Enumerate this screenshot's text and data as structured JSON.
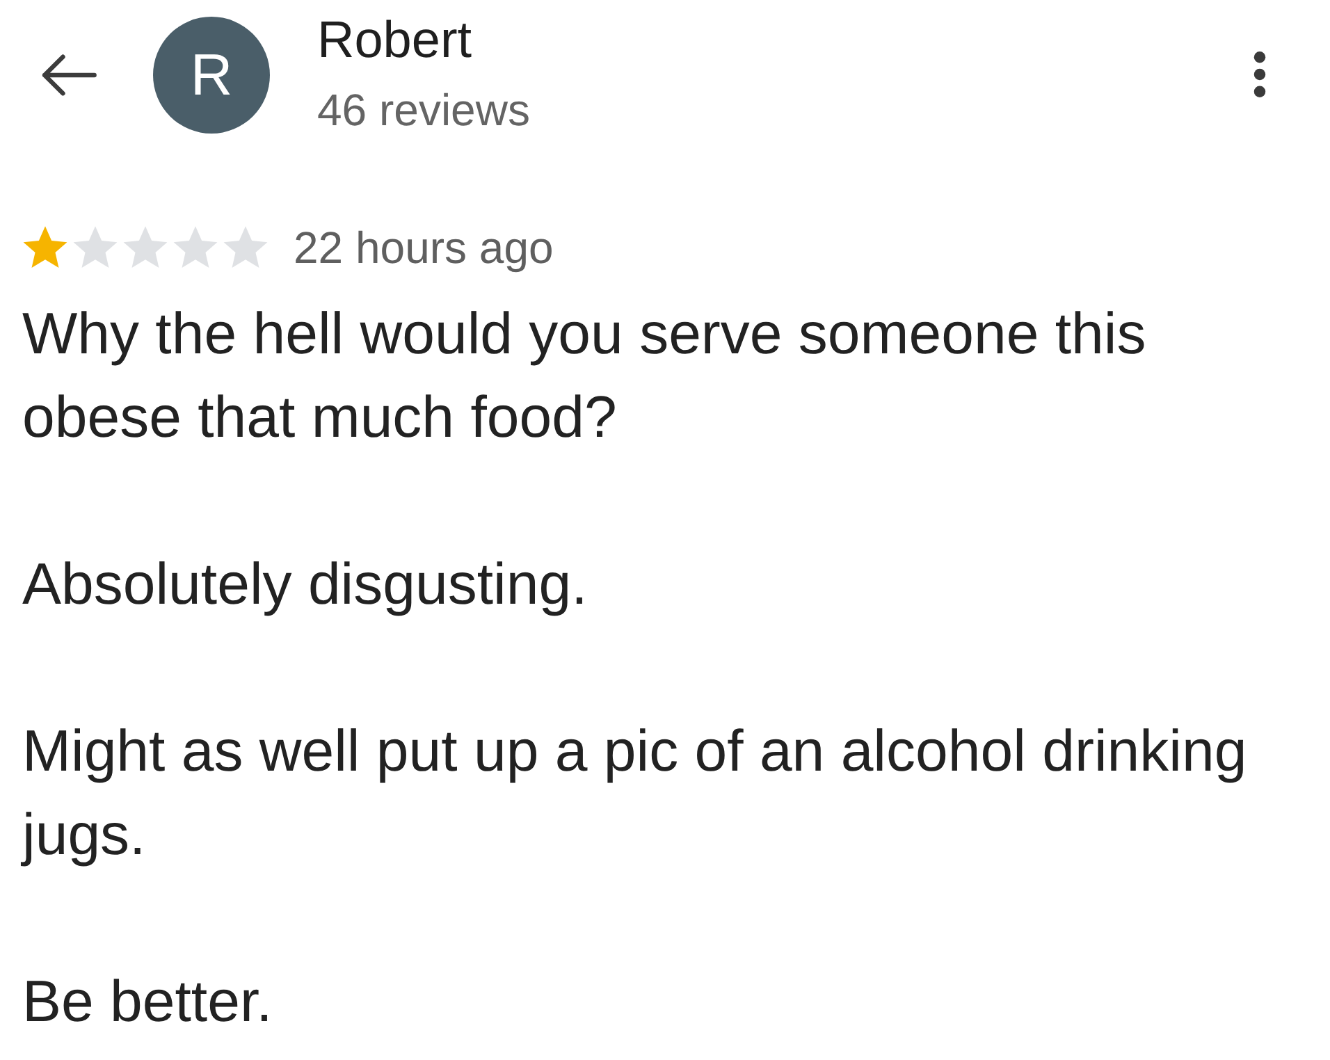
{
  "header": {
    "avatar_letter": "R",
    "name": "Robert",
    "review_count": "46 reviews"
  },
  "review": {
    "stars": 1,
    "time": "22 hours ago",
    "paragraphs": [
      "Why the hell would you serve someone this obese that much food?",
      "Absolutely disgusting.",
      "Might as well put up a pic of an alcohol drinking jugs.",
      "Be better."
    ]
  }
}
